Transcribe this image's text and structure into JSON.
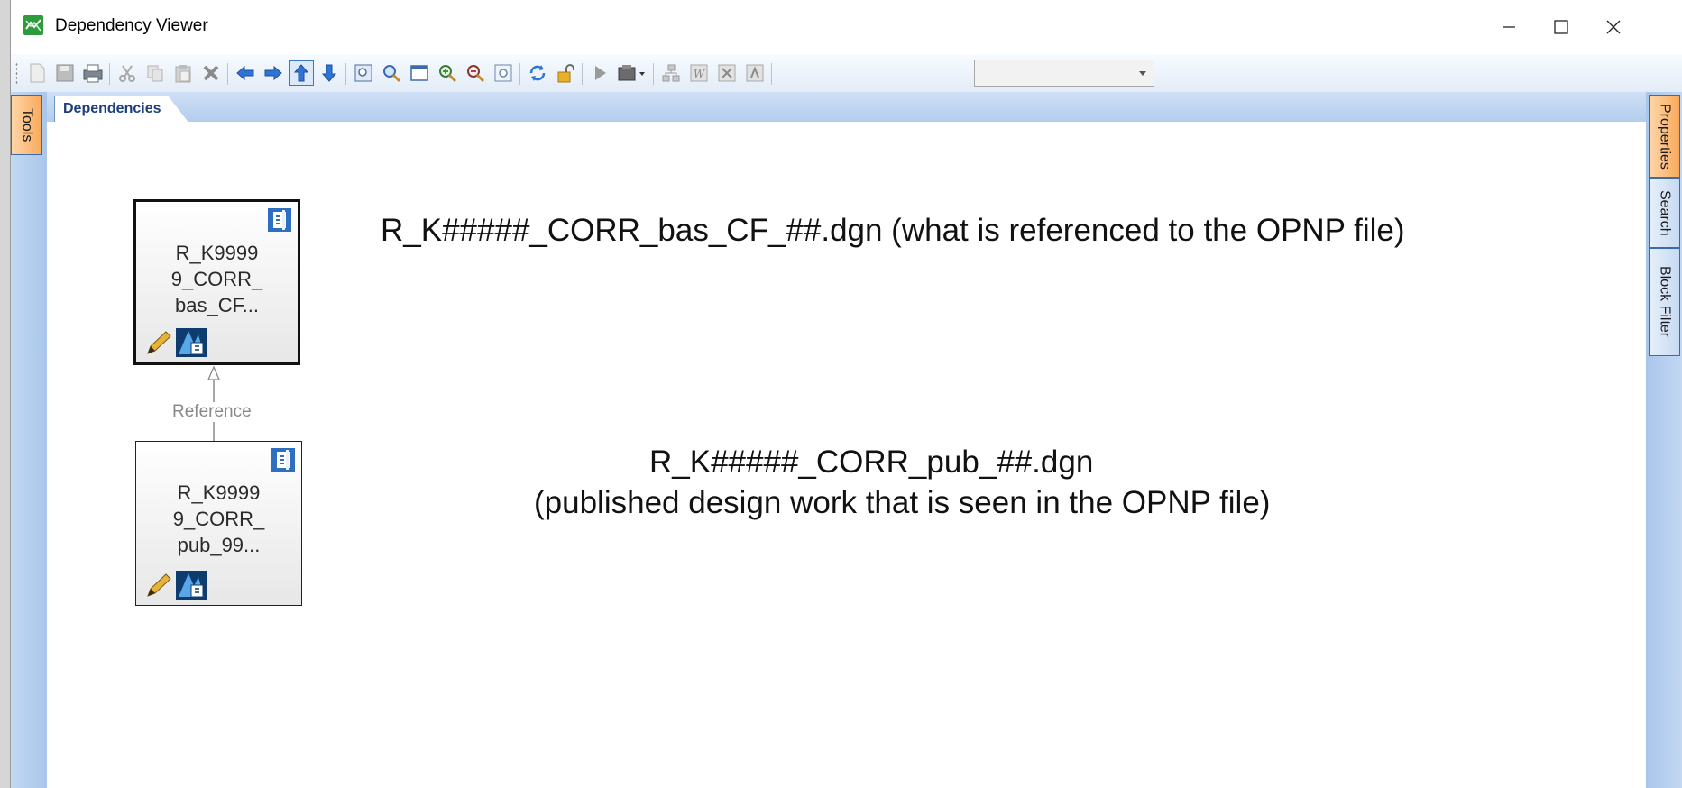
{
  "window": {
    "title": "Dependency Viewer",
    "controls": [
      "minimize",
      "maximize",
      "close"
    ],
    "icons": {
      "app": "dependency-viewer-icon"
    }
  },
  "toolbar": {
    "buttons": [
      "new",
      "save",
      "print",
      "cut",
      "copy",
      "paste",
      "delete",
      "back",
      "forward",
      "up",
      "down",
      "zoom-window",
      "zoom-find",
      "fit-view",
      "zoom-in",
      "zoom-out",
      "zoom-extents",
      "refresh",
      "unlock",
      "play",
      "package",
      "hierarchy",
      "word",
      "excel",
      "pdf"
    ],
    "active_button": "up",
    "combo_value": ""
  },
  "side_panels": {
    "left": [
      "Tools"
    ],
    "right": [
      "Properties",
      "Search",
      "Block Filter"
    ]
  },
  "document_tab": {
    "label": "Dependencies"
  },
  "graph": {
    "nodes": [
      {
        "label": "R_K9999\n9_CORR_\nbas_CF...",
        "selected": true
      },
      {
        "label": "R_K9999\n9_CORR_\npub_99...",
        "selected": false
      }
    ],
    "edge_label": "Reference"
  },
  "annotations": {
    "top": "R_K#####_CORR_bas_CF_##.dgn (what is referenced to the OPNP file)",
    "bottom_line1": "R_K#####_CORR_pub_##.dgn",
    "bottom_line2": "(published design work that is seen in the OPNP file)"
  },
  "colors": {
    "accent_orange": "#f9aa5c",
    "panel_blue": "#b4cdee",
    "selection_blue": "#3a78c4"
  }
}
